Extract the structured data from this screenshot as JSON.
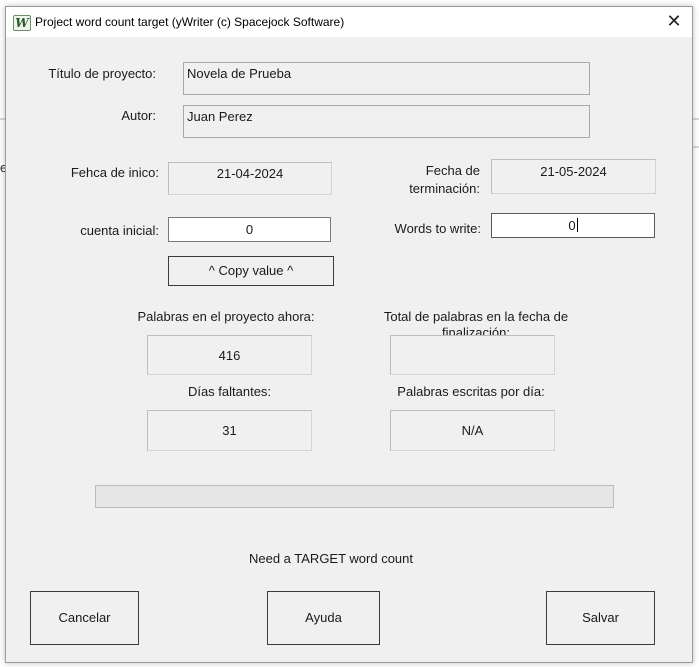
{
  "window": {
    "title": "Project word count target (yWriter (c) Spacejock Software)",
    "icon": "ywriter-app-icon",
    "close_glyph": "✕"
  },
  "background": {
    "edge_glyph": "e"
  },
  "form": {
    "project_title_label": "Título de proyecto:",
    "project_title_value": "Novela de Prueba",
    "author_label": "Autor:",
    "author_value": "Juan Perez",
    "start_date_label": "Fehca de inico:",
    "start_date_value": "21-04-2024",
    "end_date_label_line1": "Fecha de",
    "end_date_label_line2": "terminación:",
    "end_date_value": "21-05-2024",
    "initial_count_label": "cuenta inicial:",
    "initial_count_value": "0",
    "words_to_write_label": "Words to write:",
    "words_to_write_value": "0",
    "copy_value_button": "^ Copy value ^"
  },
  "stats": {
    "current_words_label": "Palabras en el proyecto ahora:",
    "current_words_value": "416",
    "total_at_end_label_line1": "Total de palabras en la fecha de",
    "total_at_end_label_line2": "finalización:",
    "total_at_end_value": "",
    "days_left_label": "Días faltantes:",
    "days_left_value": "31",
    "words_per_day_label": "Palabras escritas por día:",
    "words_per_day_value": "N/A"
  },
  "progress": {
    "fraction": 0
  },
  "status_message": "Need a TARGET word count",
  "buttons": {
    "cancel": "Cancelar",
    "help": "Ayuda",
    "save": "Salvar"
  }
}
